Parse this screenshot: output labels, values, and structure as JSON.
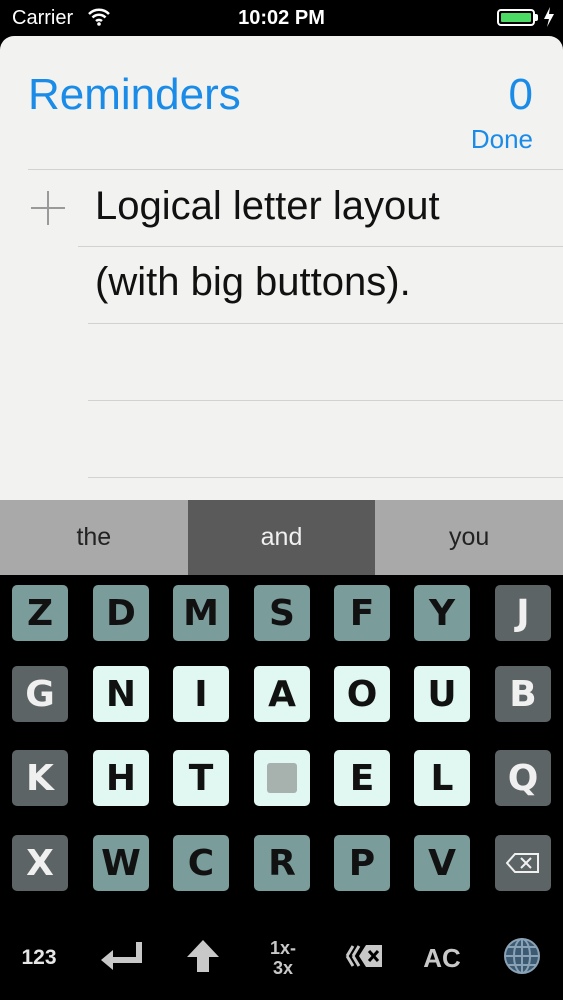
{
  "status_bar": {
    "carrier": "Carrier",
    "time": "10:02 PM",
    "battery_level": 1.0,
    "icons": [
      "wifi-icon",
      "battery-icon",
      "charging-bolt-icon"
    ]
  },
  "reminders": {
    "title": "Reminders",
    "count": "0",
    "done_label": "Done",
    "items": [
      {
        "text": "Logical letter layout"
      },
      {
        "text": "(with big buttons)."
      }
    ]
  },
  "suggestions": [
    {
      "word": "the",
      "selected": false
    },
    {
      "word": "and",
      "selected": true
    },
    {
      "word": "you",
      "selected": false
    }
  ],
  "keyboard": {
    "rows": [
      [
        {
          "label": "Z",
          "style": "teal"
        },
        {
          "label": "D",
          "style": "teal"
        },
        {
          "label": "M",
          "style": "teal"
        },
        {
          "label": "S",
          "style": "teal"
        },
        {
          "label": "F",
          "style": "teal"
        },
        {
          "label": "Y",
          "style": "teal"
        },
        {
          "label": "J",
          "style": "gray"
        }
      ],
      [
        {
          "label": "G",
          "style": "gray"
        },
        {
          "label": "N",
          "style": "light"
        },
        {
          "label": "I",
          "style": "light"
        },
        {
          "label": "A",
          "style": "light"
        },
        {
          "label": "O",
          "style": "light"
        },
        {
          "label": "U",
          "style": "light"
        },
        {
          "label": "B",
          "style": "gray"
        }
      ],
      [
        {
          "label": "K",
          "style": "gray"
        },
        {
          "label": "H",
          "style": "light"
        },
        {
          "label": "T",
          "style": "light"
        },
        {
          "label": "",
          "style": "light",
          "icon": "space-key-icon"
        },
        {
          "label": "E",
          "style": "light"
        },
        {
          "label": "L",
          "style": "light"
        },
        {
          "label": "Q",
          "style": "gray"
        }
      ],
      [
        {
          "label": "X",
          "style": "gray"
        },
        {
          "label": "W",
          "style": "teal"
        },
        {
          "label": "C",
          "style": "teal"
        },
        {
          "label": "R",
          "style": "teal"
        },
        {
          "label": "P",
          "style": "teal"
        },
        {
          "label": "V",
          "style": "teal"
        },
        {
          "label": "",
          "style": "gray",
          "icon": "backspace-icon"
        }
      ]
    ],
    "function_row": {
      "numbers_label": "123",
      "multiplier_top": "1x-",
      "multiplier_bottom": "3x",
      "clear_label": "AC",
      "icons": [
        "return-icon",
        "shift-arrow-icon",
        "delete-word-icon",
        "globe-icon"
      ]
    }
  },
  "colors": {
    "accent": "#1a8ce8",
    "key_teal": "#7a9c9a",
    "key_light": "#e0f7f2",
    "key_gray": "#5d6466",
    "suggestion_selected": "#5a5a5a"
  }
}
